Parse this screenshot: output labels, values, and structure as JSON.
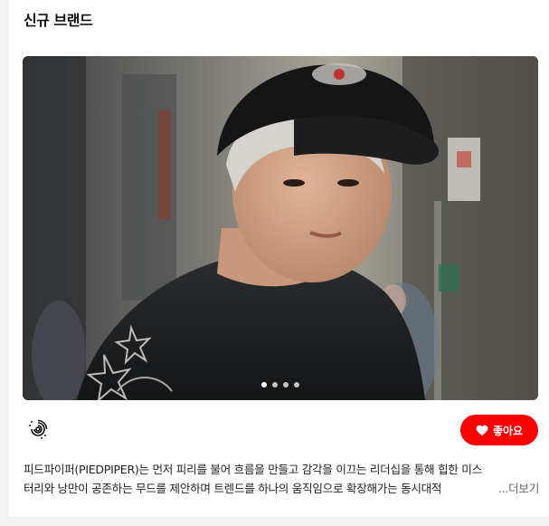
{
  "section": {
    "title": "신규 브랜드"
  },
  "hero": {
    "slide_count": 4,
    "active_slide": 1,
    "icon": "model-photo"
  },
  "brand": {
    "logo_icon": "spiral-logo-icon"
  },
  "like_button": {
    "label": "좋아요",
    "icon": "heart-icon",
    "color": "#ff0000"
  },
  "description": {
    "line1": "피드파이퍼(PIEDPIPER)는 먼저 피리를 불어 흐름을 만들고 감각을 이끄는 리더십을 통해 힙한 미스",
    "line2": "터리와 낭만이 공존하는 무드를 제안하며 트렌드를 하나의 움직임으로 확장해가는 동시대적",
    "more_label": "...더보기"
  }
}
